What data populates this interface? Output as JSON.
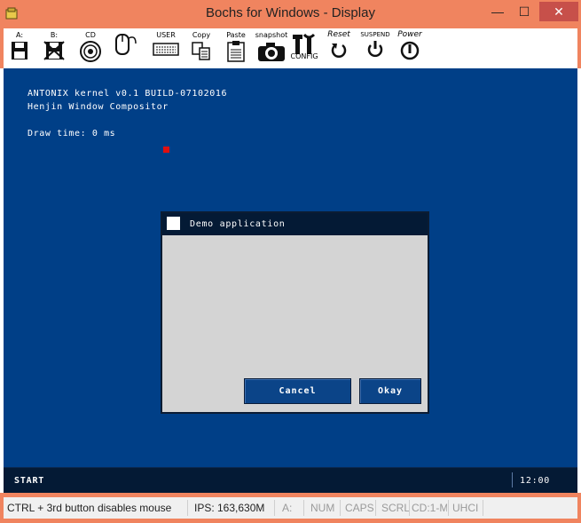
{
  "window": {
    "title": "Bochs for Windows - Display",
    "controls": {
      "minimize": "—",
      "maximize": "☐",
      "close": "✕"
    }
  },
  "toolbar": {
    "floppy_a": "A:",
    "floppy_b": "B:",
    "cdrom": "CD",
    "user": "USER",
    "copy": "Copy",
    "paste": "Paste",
    "snapshot": "snapshot",
    "config": "CONFIG",
    "reset": "Reset",
    "suspend": "SUSPEND",
    "power": "Power"
  },
  "console": {
    "line1": "ANTONIX kernel v0.1 BUILD-07102016",
    "line2": "Henjin Window Compositor",
    "line3": "Draw time: 0 ms"
  },
  "dialog": {
    "title": "Demo application",
    "cancel_label": "Cancel",
    "okay_label": "Okay"
  },
  "taskbar": {
    "start_label": "START",
    "clock": "12:00"
  },
  "statusbar": {
    "hint": "CTRL + 3rd button disables mouse",
    "ips": "IPS: 163,630M",
    "drive": "A:",
    "num": "NUM",
    "caps": "CAPS",
    "scrl": "SCRL",
    "cd": "CD:1-M",
    "uhci": "UHCI"
  },
  "colors": {
    "window_frame": "#f0845f",
    "screen_bg": "#003f87",
    "dialog_title_bg": "#041a35",
    "button_bg": "#0b4488"
  }
}
